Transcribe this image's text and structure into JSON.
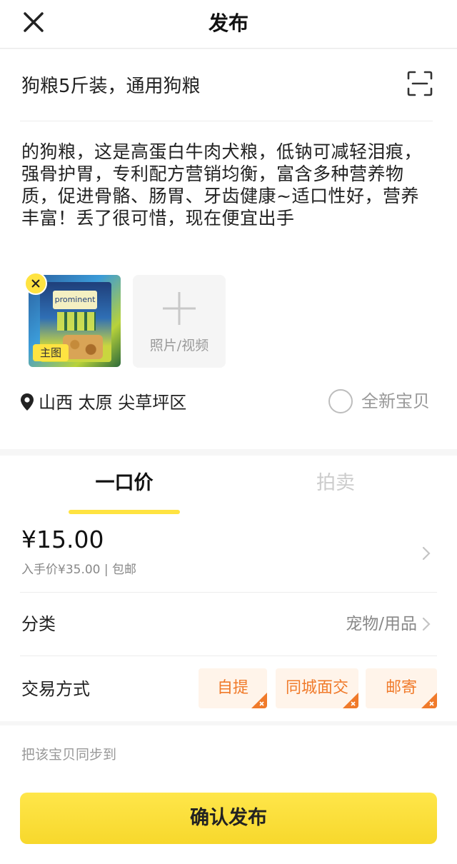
{
  "header": {
    "title": "发布",
    "close_icon": "close-icon"
  },
  "compose": {
    "title": "狗粮5斤装，通用狗粮",
    "scan_icon": "scan-icon",
    "description": "的狗粮，这是高蛋白牛肉犬粮，低钠可减轻泪痕，强骨护胃，专利配方营销均衡，富含多种营养物质，促进骨骼、肠胃、牙齿健康~适口性好，营养丰富！丢了很可惜，现在便宜出手",
    "media": {
      "main_badge": "主图",
      "add_label": "照片/视频",
      "package_text": "prominent"
    },
    "location": "山西 太原 尖草坪区",
    "new_item_label": "全新宝贝"
  },
  "pricing": {
    "tabs": [
      {
        "label": "一口价",
        "active": true
      },
      {
        "label": "拍卖",
        "active": false
      }
    ],
    "price": "¥15.00",
    "price_note": "入手价¥35.00 | 包邮",
    "category_label": "分类",
    "category_value": "宠物/用品",
    "trade_label": "交易方式",
    "trade_options": [
      "自提",
      "同城面交",
      "邮寄"
    ]
  },
  "footer": {
    "sync_text": "把该宝贝同步到",
    "confirm_label": "确认发布"
  },
  "colors": {
    "accent_yellow": "#ffe341",
    "chip_text": "#f07a2a",
    "chip_bg": "#fff4ea"
  }
}
